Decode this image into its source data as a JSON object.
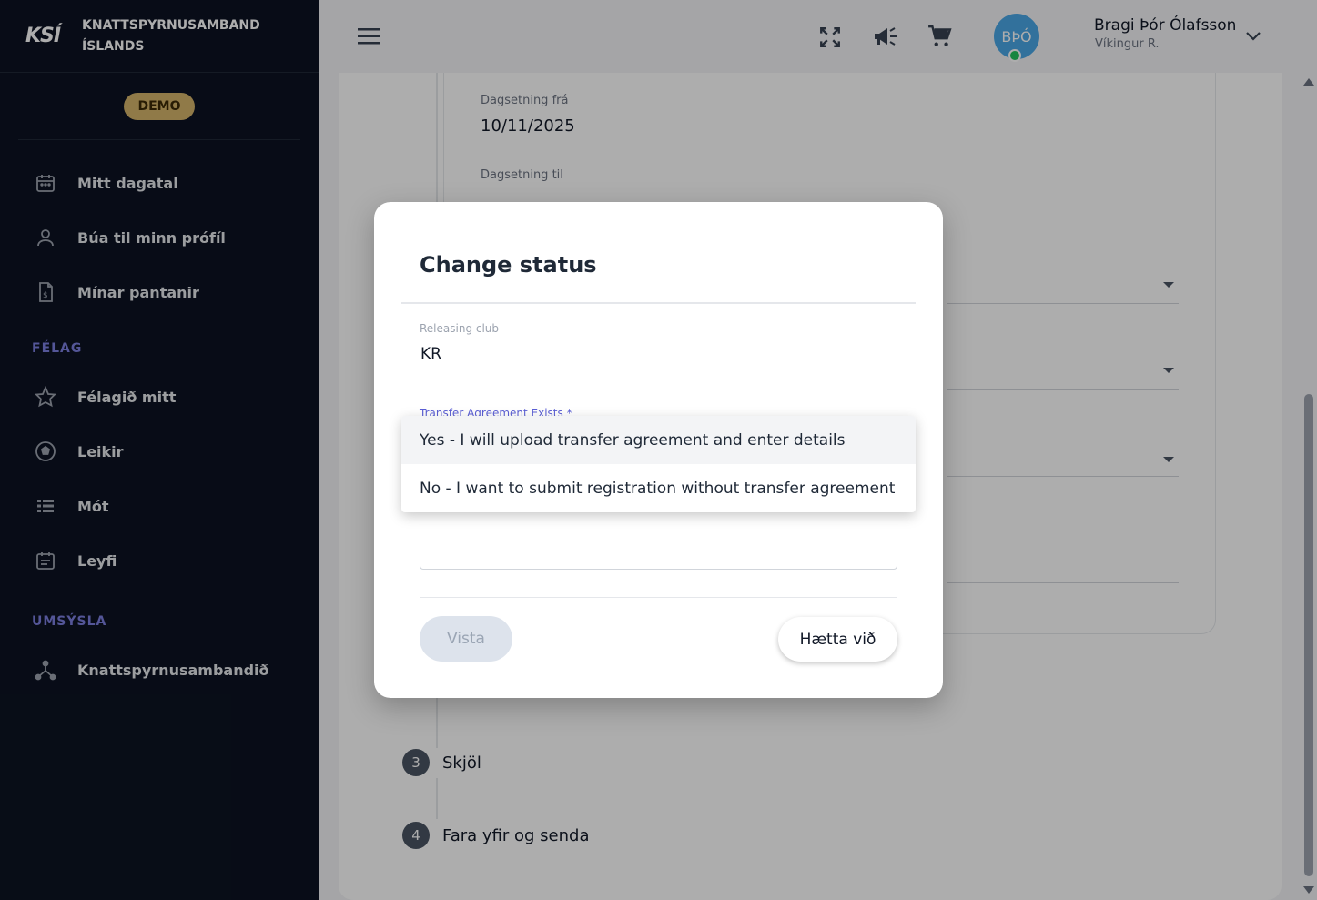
{
  "brand": {
    "logo": "KSÍ",
    "title_line1": "KNATTSPYRNUSAMBAND",
    "title_line2": "ÍSLANDS",
    "badge": "DEMO"
  },
  "sidebar": {
    "items_top": [
      {
        "label": "Mitt dagatal",
        "icon": "calendar-icon"
      },
      {
        "label": "Búa til minn prófíl",
        "icon": "person-icon"
      },
      {
        "label": "Mínar pantanir",
        "icon": "invoice-icon"
      }
    ],
    "section_felag": "FÉLAG",
    "items_felag": [
      {
        "label": "Félagið mitt",
        "icon": "star-icon"
      },
      {
        "label": "Leikir",
        "icon": "soccer-ball-icon"
      },
      {
        "label": "Mót",
        "icon": "list-icon"
      },
      {
        "label": "Leyfi",
        "icon": "calendar-note-icon"
      }
    ],
    "section_umsysla": "UMSÝSLA",
    "items_umsysla": [
      {
        "label": "Knattspyrnusambandið",
        "icon": "hierarchy-icon"
      }
    ]
  },
  "topbar": {
    "avatar_initials": "BÞÓ",
    "user_name": "Bragi Þór Ólafsson",
    "user_club": "Víkingur R."
  },
  "background": {
    "date_from_label": "Dagsetning frá",
    "date_from_value": "10/11/2025",
    "date_to_label": "Dagsetning til",
    "steps": [
      {
        "num": "3",
        "label": "Skjöl"
      },
      {
        "num": "4",
        "label": "Fara yfir og senda"
      }
    ]
  },
  "modal": {
    "title": "Change status",
    "releasing_club_label": "Releasing club",
    "releasing_club_value": "KR",
    "transfer_label": "Transfer Agreement Exists *",
    "options": [
      "Yes - I will upload transfer agreement and enter details",
      "No - I want to submit registration without transfer agreement"
    ],
    "save_label": "Vista",
    "cancel_label": "Hætta við"
  }
}
